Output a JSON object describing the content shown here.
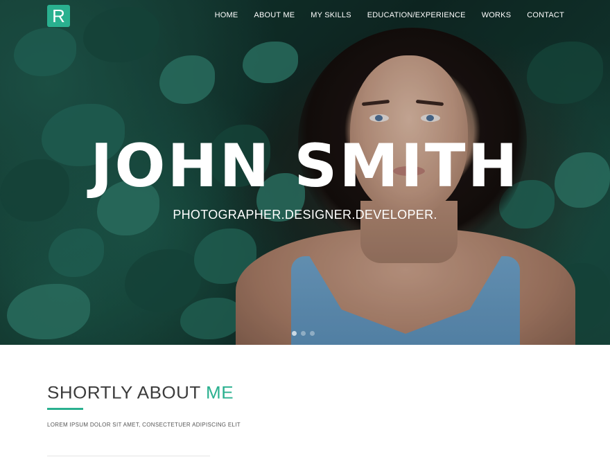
{
  "logo": {
    "letter": "R"
  },
  "nav": {
    "items": [
      "HOME",
      "ABOUT ME",
      "MY SKILLS",
      "EDUCATION/EXPERIENCE",
      "WORKS",
      "CONTACT"
    ]
  },
  "hero": {
    "title": "JOHN SMITH",
    "subtitle": "PHOTOGRAPHER.DESIGNER.DEVELOPER.",
    "slide_count": 3,
    "active_slide": 1
  },
  "about": {
    "title_main": "SHORTLY ABOUT ",
    "title_accent": "ME",
    "text": "LOREM IPSUM DOLOR SIT AMET, CONSECTETUER ADIPISCING ELIT"
  },
  "colors": {
    "accent": "#2ab08f",
    "heading": "#3c3c3c"
  }
}
